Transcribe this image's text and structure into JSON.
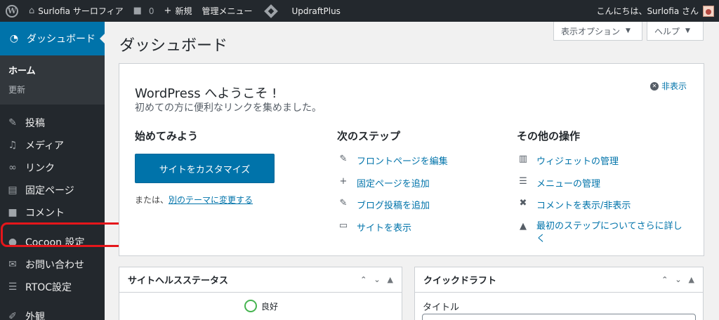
{
  "adminbar": {
    "site_name": "Surlofia サーロフィア",
    "comment_count": "0",
    "new_label": "新規",
    "admin_menu_label": "管理メニュー",
    "plugin_label": "UpdraftPlus",
    "greeting": "こんにちは、Surlofia さん"
  },
  "sidebar": {
    "dashboard_label": "ダッシュボード",
    "sub_home": "ホーム",
    "sub_updates": "更新",
    "items": [
      {
        "label": "投稿",
        "icon": "pin-icon"
      },
      {
        "label": "メディア",
        "icon": "media-icon"
      },
      {
        "label": "リンク",
        "icon": "link-icon"
      },
      {
        "label": "固定ページ",
        "icon": "page-icon"
      },
      {
        "label": "コメント",
        "icon": "comment-icon"
      },
      {
        "label": "Cocoon 設定",
        "icon": "cocoon-icon"
      },
      {
        "label": "お問い合わせ",
        "icon": "mail-icon"
      },
      {
        "label": "RTOC設定",
        "icon": "list-icon"
      },
      {
        "label": "外観",
        "icon": "appearance-icon"
      }
    ],
    "highlight_color": "#e5161b"
  },
  "main": {
    "page_title": "ダッシュボード",
    "screen_options": "表示オプション",
    "help": "ヘルプ"
  },
  "welcome": {
    "title": "WordPress へようこそ !",
    "subtitle": "初めての方に便利なリンクを集めました。",
    "dismiss": "非表示",
    "col1_title": "始めてみよう",
    "customize_button": "サイトをカスタマイズ",
    "or_text": "または、",
    "change_theme_link": "別のテーマに変更する",
    "col2_title": "次のステップ",
    "next_steps": [
      {
        "label": "フロントページを編集",
        "icon": "edit-icon"
      },
      {
        "label": "固定ページを追加",
        "icon": "plus-icon"
      },
      {
        "label": "ブログ投稿を追加",
        "icon": "edit-icon"
      },
      {
        "label": "サイトを表示",
        "icon": "view-icon"
      }
    ],
    "col3_title": "その他の操作",
    "more_actions": [
      {
        "label": "ウィジェットの管理",
        "icon": "widgets-icon"
      },
      {
        "label": "メニューの管理",
        "icon": "menu-icon"
      },
      {
        "label": "コメントを表示/非表示",
        "icon": "comment-toggle-icon"
      },
      {
        "label": "最初のステップについてさらに詳しく",
        "icon": "learn-icon"
      }
    ]
  },
  "site_health": {
    "title": "サイトヘルスステータス",
    "status": "良好"
  },
  "quick_draft": {
    "title": "クイックドラフト",
    "title_label": "タイトル"
  },
  "colors": {
    "admin_bar": "#23282d",
    "accent": "#0073aa",
    "good": "#46b450"
  }
}
